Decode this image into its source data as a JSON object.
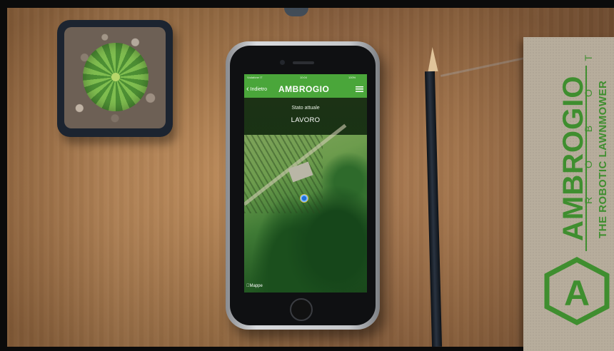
{
  "phone_app": {
    "statusbar": {
      "carrier": "Vodafone IT",
      "time": "10:04",
      "battery": "100%"
    },
    "nav": {
      "back_label": "Indietro",
      "logo_text": "AMBROGIO",
      "menu_icon": "hamburger-menu-icon"
    },
    "status": {
      "label": "Stato attuale",
      "value": "LAVORO"
    },
    "map": {
      "credit": "Mappe",
      "marker_icon": "robot-location-icon"
    }
  },
  "box": {
    "brand": "AMBROGIO",
    "subbrand": "R O B O T",
    "tagline": "THE ROBOTIC LAWNMOWER",
    "emblem": "A"
  },
  "colors": {
    "app_green": "#4aa63a",
    "brand_green": "#3f8e2f",
    "wood": "#b07a4a"
  }
}
